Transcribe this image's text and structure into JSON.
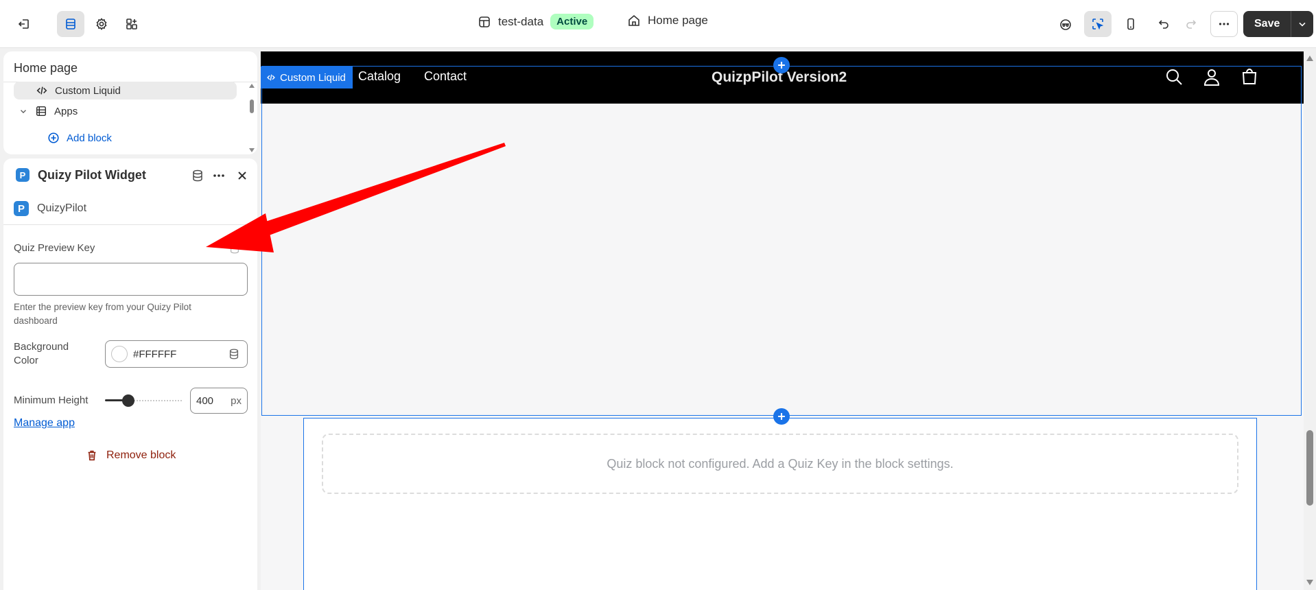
{
  "topbar": {
    "store_name": "test-data",
    "status_badge": "Active",
    "page_selector": "Home page",
    "save_label": "Save",
    "icons": [
      "exit-icon",
      "sections-icon",
      "settings-icon",
      "apps-icon",
      "store-icon",
      "home-icon",
      "sidekick-icon",
      "inspector-icon",
      "mobile-icon",
      "undo-icon",
      "redo-icon",
      "more-icon",
      "chevron-down-icon"
    ]
  },
  "sections_panel": {
    "title": "Home page",
    "items": [
      {
        "label": "Custom Liquid",
        "icon": "code-icon"
      },
      {
        "label": "Apps",
        "icon": "apps-section-icon"
      },
      {
        "label": "Add block",
        "icon": "plus-circle-icon"
      }
    ]
  },
  "block_panel": {
    "title": "Quizy Pilot Widget",
    "app_name": "QuizyPilot",
    "preview_key_label": "Quiz Preview Key",
    "preview_key_value": "",
    "preview_key_help": "Enter the preview key from your Quizy Pilot dashboard",
    "bg_color_label": "Background Color",
    "bg_color_value": "#FFFFFF",
    "min_height_label": "Minimum Height",
    "min_height_value": "400",
    "min_height_unit": "px",
    "min_height_fraction": 0.3,
    "manage_app_label": "Manage app",
    "remove_block_label": "Remove block"
  },
  "preview": {
    "selected_block_tab": "Custom Liquid",
    "nav_links": [
      "Catalog",
      "Contact"
    ],
    "store_title": "QuizpPilot Version2",
    "quiz_placeholder": "Quiz block not configured. Add a Quiz Key in the block settings.",
    "colors": {
      "accent": "#1a73e8",
      "header_bg": "#000000"
    }
  },
  "annotation": {
    "arrow_color": "#ff0000"
  }
}
